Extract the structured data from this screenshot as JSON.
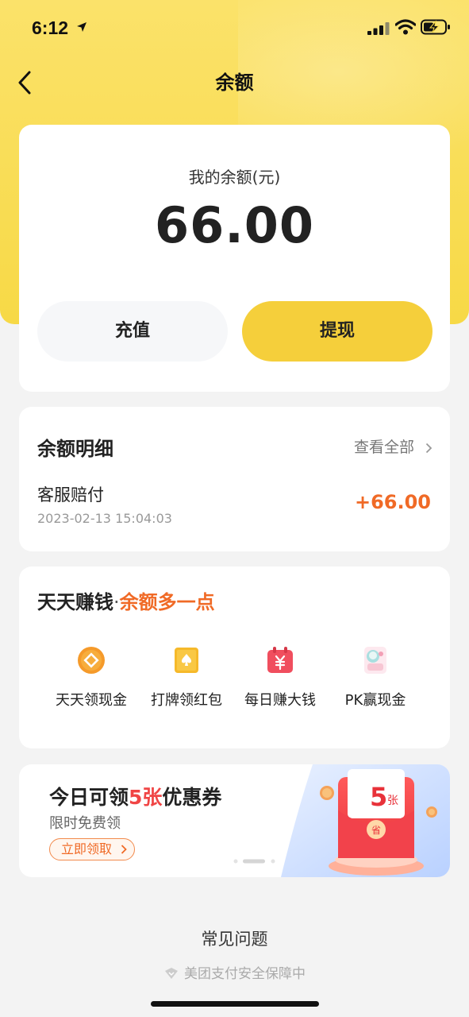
{
  "status_bar": {
    "time": "6:12"
  },
  "nav": {
    "title": "余额"
  },
  "balance": {
    "label": "我的余额(元)",
    "amount": "66.00",
    "recharge_label": "充值",
    "withdraw_label": "提现"
  },
  "details": {
    "title": "余额明细",
    "view_all": "查看全部",
    "transaction": {
      "name": "客服赔付",
      "time": "2023-02-13 15:04:03",
      "amount": "+66.00"
    }
  },
  "earn": {
    "title_main": "天天赚钱",
    "title_sep": "·",
    "title_accent": "余额多一点",
    "items": [
      {
        "label": "天天领现金",
        "icon": "coin-icon"
      },
      {
        "label": "打牌领红包",
        "icon": "card-game-icon"
      },
      {
        "label": "每日赚大钱",
        "icon": "calendar-money-icon"
      },
      {
        "label": "PK赢现金",
        "icon": "pk-icon"
      }
    ]
  },
  "banner": {
    "title_pre": "今日可领",
    "title_highlight": "5张",
    "title_post": "优惠券",
    "subtitle": "限时免费领",
    "button": "立即领取",
    "coupon_count": "5",
    "coupon_unit": "张",
    "coupon_stamp": "省"
  },
  "footer": {
    "faq": "常见问题",
    "security": "美团支付安全保障中"
  },
  "colors": {
    "brand_yellow": "#f7d946",
    "accent_orange": "#f06a26",
    "red": "#f04545"
  }
}
